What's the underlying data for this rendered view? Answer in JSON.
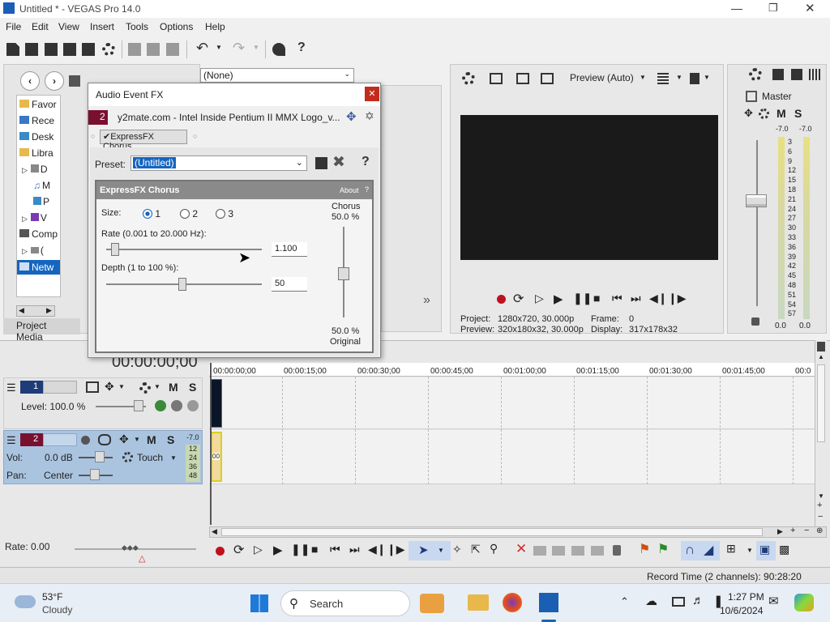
{
  "window": {
    "title": "Untitled * - VEGAS Pro 14.0"
  },
  "menu": [
    "File",
    "Edit",
    "View",
    "Insert",
    "Tools",
    "Options",
    "Help"
  ],
  "explorer": {
    "items": [
      "Favor",
      "Rece",
      "Desk",
      "Libra",
      "D",
      "M",
      "P",
      "V",
      "Comp",
      "(",
      "Netw"
    ],
    "tab_label": "Project Media"
  },
  "fx_combo": "(None)",
  "preview": {
    "mode": "Preview (Auto)",
    "project_label": "Project:",
    "project_value": "1280x720, 30.000p",
    "preview_label": "Preview:",
    "preview_value": "320x180x32, 30.000p",
    "frame_label": "Frame:",
    "frame_value": "0",
    "display_label": "Display:",
    "display_value": "317x178x32"
  },
  "master": {
    "title": "Master",
    "left_db": "-7.0",
    "right_db": "-7.0",
    "scale": [
      "3",
      "6",
      "9",
      "12",
      "15",
      "18",
      "21",
      "24",
      "27",
      "30",
      "33",
      "36",
      "39",
      "42",
      "45",
      "48",
      "51",
      "54",
      "57"
    ],
    "bottom_left": "0.0",
    "bottom_right": "0.0"
  },
  "dialog": {
    "title": "Audio Event FX",
    "event_number": "2",
    "event_name": "y2mate.com - Intel Inside Pentium II MMX Logo_v...",
    "chain_label": "ExpressFX Chorus",
    "preset_label": "Preset:",
    "preset_value": "(Untitled)",
    "plugin_name": "ExpressFX Chorus",
    "about_label": "About",
    "help_label": "?",
    "size_label": "Size:",
    "size_options": [
      "1",
      "2",
      "3"
    ],
    "rate_label": "Rate (0.001 to 20.000 Hz):",
    "rate_value": "1.100",
    "depth_label": "Depth (1 to 100 %):",
    "depth_value": "50",
    "chorus_label": "Chorus",
    "chorus_top_pct": "50.0 %",
    "chorus_bottom_pct": "50.0 %",
    "original_label": "Original"
  },
  "timeline": {
    "timecode": "00:00:00;00",
    "ruler": [
      "00:00:00;00",
      "00:00:15;00",
      "00:00:30;00",
      "00:00:45;00",
      "00:01:00;00",
      "00:01:15;00",
      "00:01:30;00",
      "00:01:45;00",
      "00:0"
    ],
    "track1": {
      "number": "1",
      "level_label": "Level: 100.0 %"
    },
    "track2": {
      "number": "2",
      "vol_label": "Vol:",
      "vol_value": "0.0 dB",
      "pan_label": "Pan:",
      "pan_value": "Center",
      "automation": "Touch",
      "meter_top": "-7.0",
      "meter_vals": [
        "12",
        "24",
        "36",
        "48"
      ]
    },
    "m_label": "M",
    "s_label": "S",
    "clip_label": "00"
  },
  "transport": {
    "rate_label": "Rate: 0.00"
  },
  "status": {
    "record_time": "Record Time (2 channels): 90:28:20"
  },
  "taskbar": {
    "weather_temp": "53°F",
    "weather_desc": "Cloudy",
    "search_placeholder": "Search",
    "time": "1:27 PM",
    "date": "10/6/2024"
  },
  "colors": {
    "accent": "#1565c0",
    "track_bg": "#aac4e0",
    "preview_black": "#1a1a1a",
    "track_red": "#7a1030"
  }
}
